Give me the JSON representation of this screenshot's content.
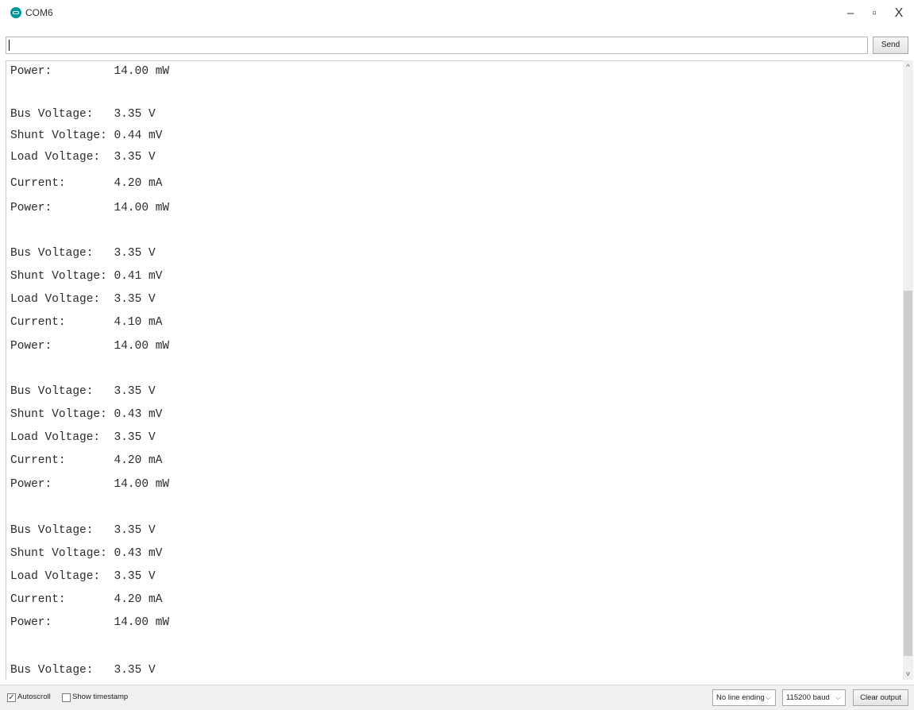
{
  "window": {
    "title": "COM6",
    "minimize_glyph": "–",
    "maximize_glyph": "▫",
    "close_glyph": "X"
  },
  "send_row": {
    "input_value": "",
    "send_label": "Send"
  },
  "output": {
    "lines": [
      "Power:         14.00 mW",
      "",
      "Bus Voltage:   3.35 V",
      "Shunt Voltage: 0.44 mV",
      "Load Voltage:  3.35 V",
      "Current:       4.20 mA",
      "Power:         14.00 mW",
      "",
      "Bus Voltage:   3.35 V",
      "Shunt Voltage: 0.41 mV",
      "Load Voltage:  3.35 V",
      "Current:       4.10 mA",
      "Power:         14.00 mW",
      "",
      "Bus Voltage:   3.35 V",
      "Shunt Voltage: 0.43 mV",
      "Load Voltage:  3.35 V",
      "Current:       4.20 mA",
      "Power:         14.00 mW",
      "",
      "Bus Voltage:   3.35 V",
      "Shunt Voltage: 0.43 mV",
      "Load Voltage:  3.35 V",
      "Current:       4.20 mA",
      "Power:         14.00 mW",
      "",
      "Bus Voltage:   3.35 V"
    ]
  },
  "scrollbar": {
    "up_glyph": "^",
    "down_glyph": "v"
  },
  "bottom_bar": {
    "autoscroll_label": "Autoscroll",
    "autoscroll_checked": true,
    "autoscroll_check_glyph": "✓",
    "timestamp_label": "Show timestamp",
    "timestamp_checked": false,
    "line_ending_value": "No line ending",
    "baud_value": "115200 baud",
    "chevron_glyph": "⌵",
    "clear_label": "Clear output"
  },
  "colors": {
    "arduino_teal": "#00979c",
    "scroll_thumb": "#cdcdcd"
  }
}
